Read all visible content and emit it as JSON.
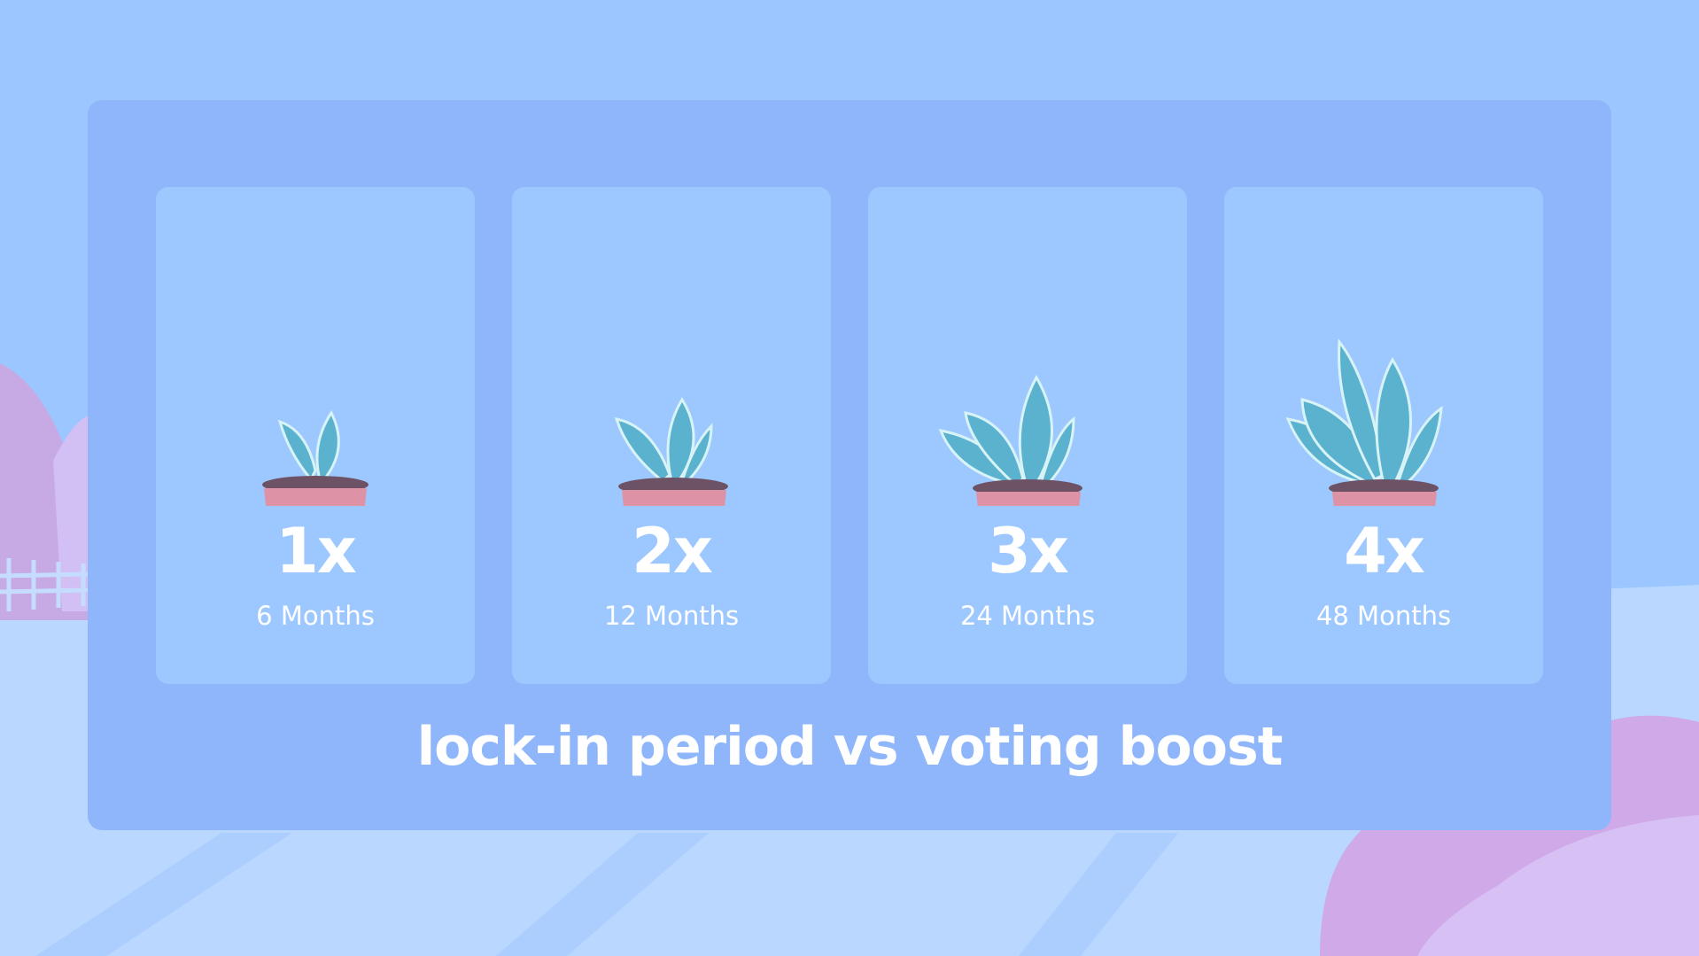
{
  "colors": {
    "background": "#9cc6ff",
    "panel": "#8fb6fa",
    "card": "#9dc8ff",
    "text": "#ffffff",
    "pot": "#dd93a5",
    "soil": "#6d5266",
    "leaf": "#5ab2cf",
    "leaf_edge": "#d8f3f5",
    "hill_pink": "#c9a8e6",
    "hill_light": "#bcd9ff"
  },
  "cards": [
    {
      "multiplier": "1x",
      "period": "6 Months",
      "face": "sleepy-face-icon"
    },
    {
      "multiplier": "2x",
      "period": "12 Months",
      "face": "smile-face-icon"
    },
    {
      "multiplier": "3x",
      "period": "24 Months",
      "face": "happy-face-icon"
    },
    {
      "multiplier": "4x",
      "period": "48 Months",
      "face": "excited-face-icon"
    }
  ],
  "caption": "lock-in period vs voting boost"
}
